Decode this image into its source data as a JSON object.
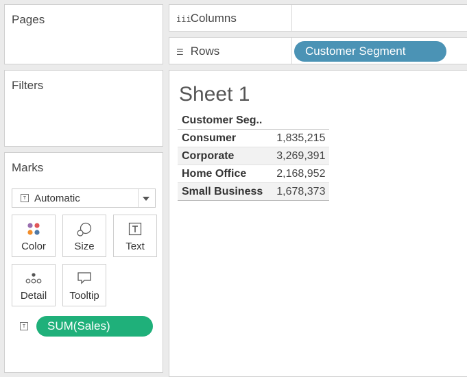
{
  "panels": {
    "pages_title": "Pages",
    "filters_title": "Filters",
    "marks_title": "Marks"
  },
  "marks": {
    "type_value": "Automatic",
    "buttons": [
      {
        "label": "Color",
        "icon": "color-dots-icon"
      },
      {
        "label": "Size",
        "icon": "size-circles-icon"
      },
      {
        "label": "Text",
        "icon": "text-t-icon"
      },
      {
        "label": "Detail",
        "icon": "detail-dots-icon"
      },
      {
        "label": "Tooltip",
        "icon": "tooltip-bubble-icon"
      }
    ],
    "sales_pill": "SUM(Sales)",
    "sales_pill_color": "#1fb07a"
  },
  "shelves": {
    "columns_label": "Columns",
    "rows_label": "Rows",
    "rows_pill": "Customer Segment",
    "rows_pill_color": "#4b93b5"
  },
  "sheet": {
    "title": "Sheet 1",
    "header": "Customer Seg..",
    "rows": [
      {
        "segment": "Consumer",
        "value": "1,835,215"
      },
      {
        "segment": "Corporate",
        "value": "3,269,391"
      },
      {
        "segment": "Home Office",
        "value": "2,168,952"
      },
      {
        "segment": "Small Business",
        "value": "1,678,373"
      }
    ]
  }
}
